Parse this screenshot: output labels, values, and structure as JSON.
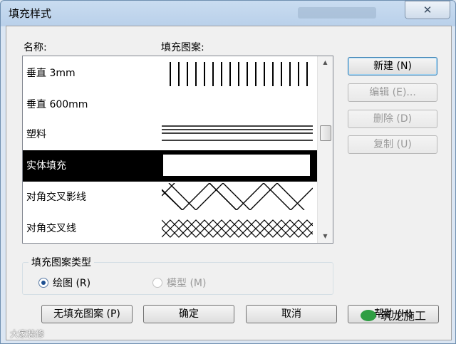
{
  "window": {
    "title": "填充样式",
    "close_symbol": "✕"
  },
  "list": {
    "header_name": "名称:",
    "header_pattern": "填充图案:",
    "items": [
      {
        "name": "垂直 3mm",
        "pattern": "vertical-lines",
        "selected": false
      },
      {
        "name": "垂直 600mm",
        "pattern": "none",
        "selected": false
      },
      {
        "name": "塑料",
        "pattern": "horizontal-lines",
        "selected": false
      },
      {
        "name": "实体填充",
        "pattern": "solid",
        "selected": true
      },
      {
        "name": "对角交叉影线",
        "pattern": "diagonal-cross-wide",
        "selected": false
      },
      {
        "name": "对角交叉线",
        "pattern": "diagonal-cross-dense",
        "selected": false
      }
    ]
  },
  "side_buttons": {
    "new": "新建 (N)",
    "edit": "编辑 (E)...",
    "delete": "删除 (D)",
    "copy": "复制 (U)"
  },
  "pattern_type": {
    "legend": "填充图案类型",
    "drafting": "绘图 (R)",
    "model": "模型 (M)",
    "selected": "drafting"
  },
  "bottom_buttons": {
    "no_fill": "无填充图案 (P)",
    "ok": "确定",
    "cancel": "取消",
    "help": "帮助 (H)"
  },
  "watermark": {
    "left": "大家装修",
    "right": "筑龙施工"
  }
}
